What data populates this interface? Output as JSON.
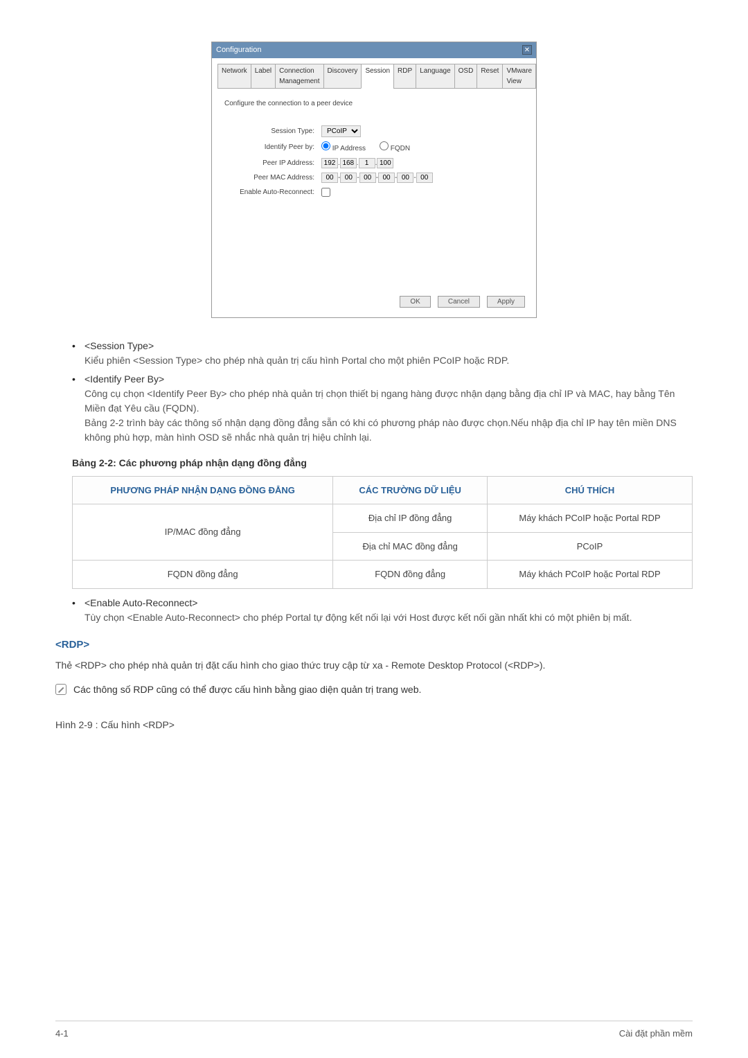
{
  "dialog": {
    "title": "Configuration",
    "tabs": [
      "Network",
      "Label",
      "Connection Management",
      "Discovery",
      "Session",
      "RDP",
      "Language",
      "OSD",
      "Reset",
      "VMware View"
    ],
    "active_tab": "Session",
    "desc": "Configure the connection to a peer device",
    "session_type_label": "Session Type:",
    "session_type_value": "PCoIP",
    "identify_peer_label": "Identify Peer by:",
    "identify_ip": "IP Address",
    "identify_fqdn": "FQDN",
    "peer_ip_label": "Peer IP Address:",
    "peer_ip": [
      "192",
      "168",
      "1",
      "100"
    ],
    "peer_mac_label": "Peer MAC Address:",
    "peer_mac": [
      "00",
      "00",
      "00",
      "00",
      "00",
      "00"
    ],
    "auto_reconnect_label": "Enable Auto-Reconnect:",
    "btn_ok": "OK",
    "btn_cancel": "Cancel",
    "btn_apply": "Apply"
  },
  "bullets": [
    {
      "title": "<Session Type>",
      "body": "Kiểu phiên <Session Type> cho phép nhà quản trị cấu hình Portal cho một phiên PCoIP hoặc RDP."
    },
    {
      "title": "<Identify Peer By>",
      "body": "Công cụ chọn <Identify Peer By> cho phép nhà quản trị chọn thiết bị ngang hàng được nhận dạng bằng địa chỉ IP và MAC, hay bằng Tên Miền đạt Yêu cầu (FQDN).",
      "body2": "Bảng 2-2 trình bày các thông số nhận dạng đồng đẳng sẵn có khi có phương pháp nào được chọn.Nếu nhập địa chỉ IP hay tên miền DNS không phù hợp, màn hình OSD sẽ nhắc nhà quản trị hiệu chỉnh lại."
    }
  ],
  "table_caption": "Bảng 2-2: Các phương pháp nhận dạng đồng đẳng",
  "table": {
    "headers": [
      "PHƯƠNG PHÁP NHẬN DẠNG ĐỒNG ĐẲNG",
      "CÁC TRƯỜNG DỮ LIỆU",
      "CHÚ THÍCH"
    ],
    "rows": [
      {
        "method": "IP/MAC đồng đẳng",
        "field": "Địa chỉ IP đồng đẳng",
        "note": "Máy khách PCoIP hoặc Portal RDP",
        "rowspan": 2
      },
      {
        "field": "Địa chỉ MAC đồng đẳng",
        "note": "PCoIP"
      },
      {
        "method": "FQDN đồng đẳng",
        "field": "FQDN đồng đẳng",
        "note": "Máy khách PCoIP hoặc Portal RDP"
      }
    ]
  },
  "bullet3_title": "<Enable Auto-Reconnect>",
  "bullet3_body": "Tùy chọn <Enable Auto-Reconnect> cho phép Portal tự động kết nối lại với Host được kết nối gần nhất khi có một phiên bị mất.",
  "rdp_heading": "<RDP>",
  "rdp_body": "Thẻ <RDP> cho phép nhà quản trị đặt cấu hình cho giao thức truy cập từ xa - Remote Desktop Protocol (<RDP>).",
  "rdp_note": "Các thông số RDP cũng có thể được cấu hình bằng giao diện quản trị trang web.",
  "figure_caption": "Hình  2-9 : Cấu hình <RDP>",
  "footer_left": "4-1",
  "footer_right": "Cài đặt phần mềm"
}
